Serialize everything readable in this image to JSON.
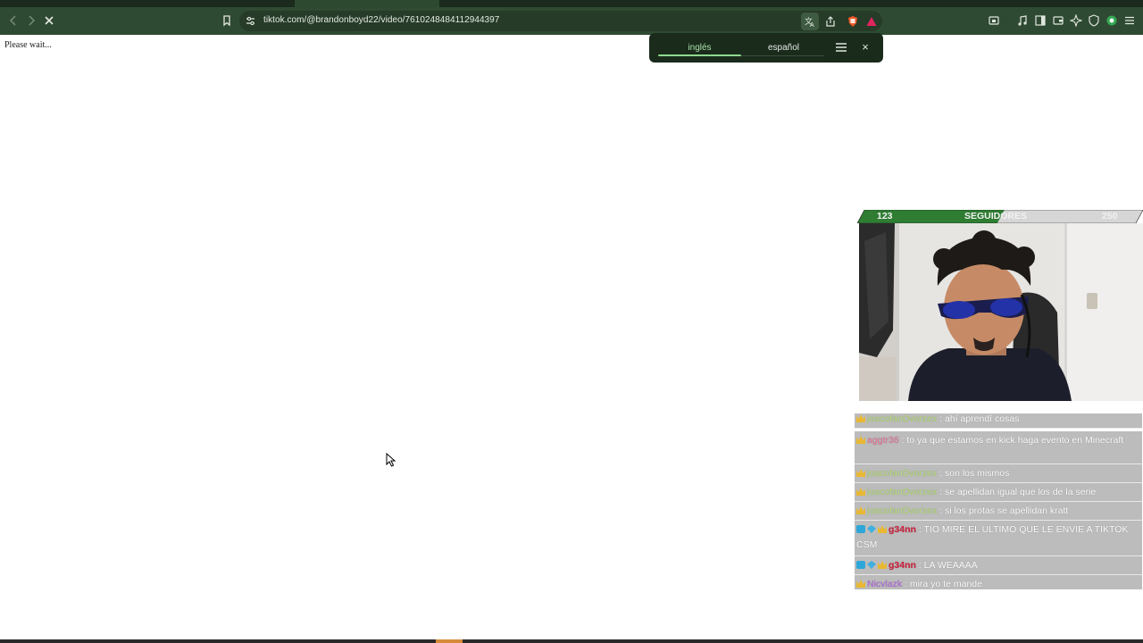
{
  "browser": {
    "url": "tiktok.com/@brandonboyd22/video/7610248484112944397"
  },
  "page": {
    "status_text": "Please wait..."
  },
  "translate": {
    "source_lang": "inglés",
    "target_lang": "español",
    "close_glyph": "×"
  },
  "overlay": {
    "goal": {
      "current": "123",
      "label": "SEGUIDORES",
      "target": "250",
      "progress": 0.49
    },
    "chat": [
      {
        "badges": [
          "crown"
        ],
        "user": "joacofanDvorzex",
        "color": "green",
        "text": ": ahí aprendí cosas"
      },
      {
        "badges": [
          "crown"
        ],
        "user": "aggtr36",
        "color": "pink",
        "text": ": to ya que estamos en kick haga evento en Minecraft"
      },
      {
        "badges": [
          "crown"
        ],
        "user": "joacofanDvorzex",
        "color": "green",
        "text": ": son los mismos"
      },
      {
        "badges": [
          "crown"
        ],
        "user": "joacofanDvorzex",
        "color": "green",
        "text": ": se apellidan igual que los de la serie"
      },
      {
        "badges": [
          "crown"
        ],
        "user": "joacofanDvorzex",
        "color": "green",
        "text": ": si los protas se apellidan kratt"
      },
      {
        "badges": [
          "blue",
          "gem",
          "crown"
        ],
        "user": "g34nn",
        "color": "red",
        "text": ": TIO MIRE EL ULTIMO QUE LE ENVIE A TIKTOK CSM"
      },
      {
        "badges": [
          "blue",
          "gem",
          "crown"
        ],
        "user": "g34nn",
        "color": "red",
        "text": ": LA WEAAAA"
      },
      {
        "badges": [
          "crown"
        ],
        "user": "Nicvlazk",
        "color": "purple",
        "text": ": mira yo te mande"
      }
    ]
  },
  "icons": {
    "back": "arrow-left-icon",
    "forward": "arrow-right-icon",
    "stop": "close-icon",
    "bookmark": "bookmark-icon",
    "site_info": "tune-icon",
    "translate": "translate-icon",
    "share": "share-icon",
    "shields": "brave-shields-icon",
    "rewards": "brave-rewards-icon",
    "right_toolbar": [
      "screenshot-icon",
      "music-icon",
      "sidebar-icon",
      "wallet-icon",
      "leo-icon",
      "vpn-icon",
      "profile-icon",
      "menu-icon"
    ]
  },
  "colors": {
    "toolbar": "#2f4a32",
    "goal_bar": "#2e7d32",
    "chat_bg": "#bcbcbc"
  }
}
